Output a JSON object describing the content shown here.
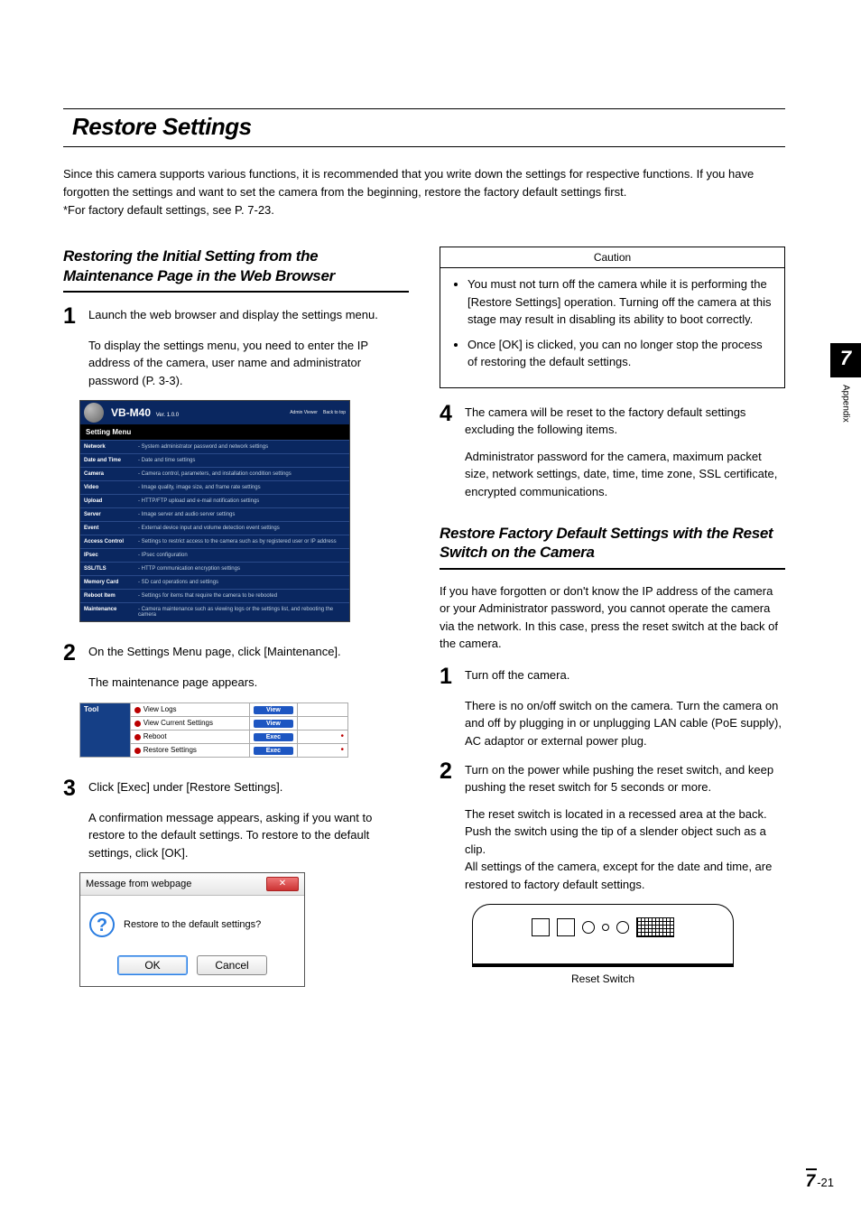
{
  "page": {
    "title": "Restore Settings",
    "intro": "Since this camera supports various functions, it is recommended that you write down the settings for respective functions. If you have forgotten the settings and want to set the camera from the beginning, restore the factory default settings first.\n*For factory default settings, see P. 7-23."
  },
  "left": {
    "heading": "Restoring the Initial Setting from the Maintenance Page in the Web Browser",
    "step1": {
      "num": "1",
      "text": "Launch the web browser and display the settings menu.",
      "sub": "To display the settings menu, you need to enter the IP address of the camera, user name and administrator password (P. 3-3)."
    },
    "settings_menu": {
      "model": "VB-M40",
      "version": "Ver. 1.0.0",
      "links": [
        "Admin Viewer",
        "Back to top"
      ],
      "menu_title": "Setting Menu",
      "rows": [
        {
          "l": "Network",
          "r": "System administrator password and network settings"
        },
        {
          "l": "Date and Time",
          "r": "Date and time settings"
        },
        {
          "l": "Camera",
          "r": "Camera control, parameters, and installation condition settings"
        },
        {
          "l": "Video",
          "r": "Image quality, image size, and frame rate settings"
        },
        {
          "l": "Upload",
          "r": "HTTP/FTP upload and e-mail notification settings"
        },
        {
          "l": "Server",
          "r": "Image server and audio server settings"
        },
        {
          "l": "Event",
          "r": "External device input and volume detection event settings"
        },
        {
          "l": "Access Control",
          "r": "Settings to restrict access to the camera such as by registered user or IP address"
        },
        {
          "l": "IPsec",
          "r": "IPsec configuration"
        },
        {
          "l": "SSL/TLS",
          "r": "HTTP communication encryption settings"
        },
        {
          "l": "Memory Card",
          "r": "SD card operations and settings"
        },
        {
          "l": "Reboot Item",
          "r": "Settings for items that require the camera to be rebooted"
        },
        {
          "l": "Maintenance",
          "r": "Camera maintenance such as viewing logs or the settings list, and rebooting the camera"
        }
      ]
    },
    "step2": {
      "num": "2",
      "text": "On the Settings Menu page, click [Maintenance].",
      "sub": "The maintenance page appears."
    },
    "tool_table": {
      "label": "Tool",
      "rows": [
        {
          "name": "View Logs",
          "btn": "View",
          "flag": false
        },
        {
          "name": "View Current Settings",
          "btn": "View",
          "flag": false
        },
        {
          "name": "Reboot",
          "btn": "Exec",
          "flag": true
        },
        {
          "name": "Restore Settings",
          "btn": "Exec",
          "flag": true
        }
      ]
    },
    "step3": {
      "num": "3",
      "text": "Click [Exec] under [Restore Settings].",
      "sub": "A confirmation message appears, asking if you want to restore to the default settings. To restore to the default settings, click [OK]."
    },
    "dialog": {
      "title": "Message from webpage",
      "body": "Restore to the default settings?",
      "ok": "OK",
      "cancel": "Cancel"
    }
  },
  "right": {
    "caution": {
      "title": "Caution",
      "items": [
        "You must not turn off the camera while it is performing the [Restore Settings] operation. Turning off the camera at this stage may result in disabling its ability to boot correctly.",
        "Once [OK] is clicked, you can no longer stop the process of restoring the default settings."
      ]
    },
    "step4": {
      "num": "4",
      "text": "The camera will be reset to the factory default settings excluding the following items.",
      "sub": "Administrator password for the camera, maximum packet size, network settings, date, time, time zone, SSL certificate, encrypted communications."
    },
    "heading2": "Restore Factory Default Settings with the Reset Switch on the Camera",
    "intro2": "If you have forgotten or don't know the IP address of the camera or your Administrator password, you cannot operate the camera via the network. In this case, press the reset switch at the back of the camera.",
    "step_r1": {
      "num": "1",
      "text": "Turn off the camera.",
      "sub": "There is no on/off switch on the camera. Turn the camera on and off by plugging in or unplugging LAN cable (PoE supply), AC adaptor or external power plug."
    },
    "step_r2": {
      "num": "2",
      "text": "Turn on the power while pushing the reset switch, and keep pushing the reset switch for 5 seconds or more.",
      "sub": "The reset switch is located in a recessed area at the back. Push the switch using the tip of a slender object such as a clip.\nAll settings of the camera, except for the date and time, are restored to factory default settings."
    },
    "diagram_caption": "Reset Switch"
  },
  "side": {
    "chapter": "7",
    "label": "Appendix"
  },
  "footer": {
    "chapter": "7",
    "page": "-21"
  }
}
